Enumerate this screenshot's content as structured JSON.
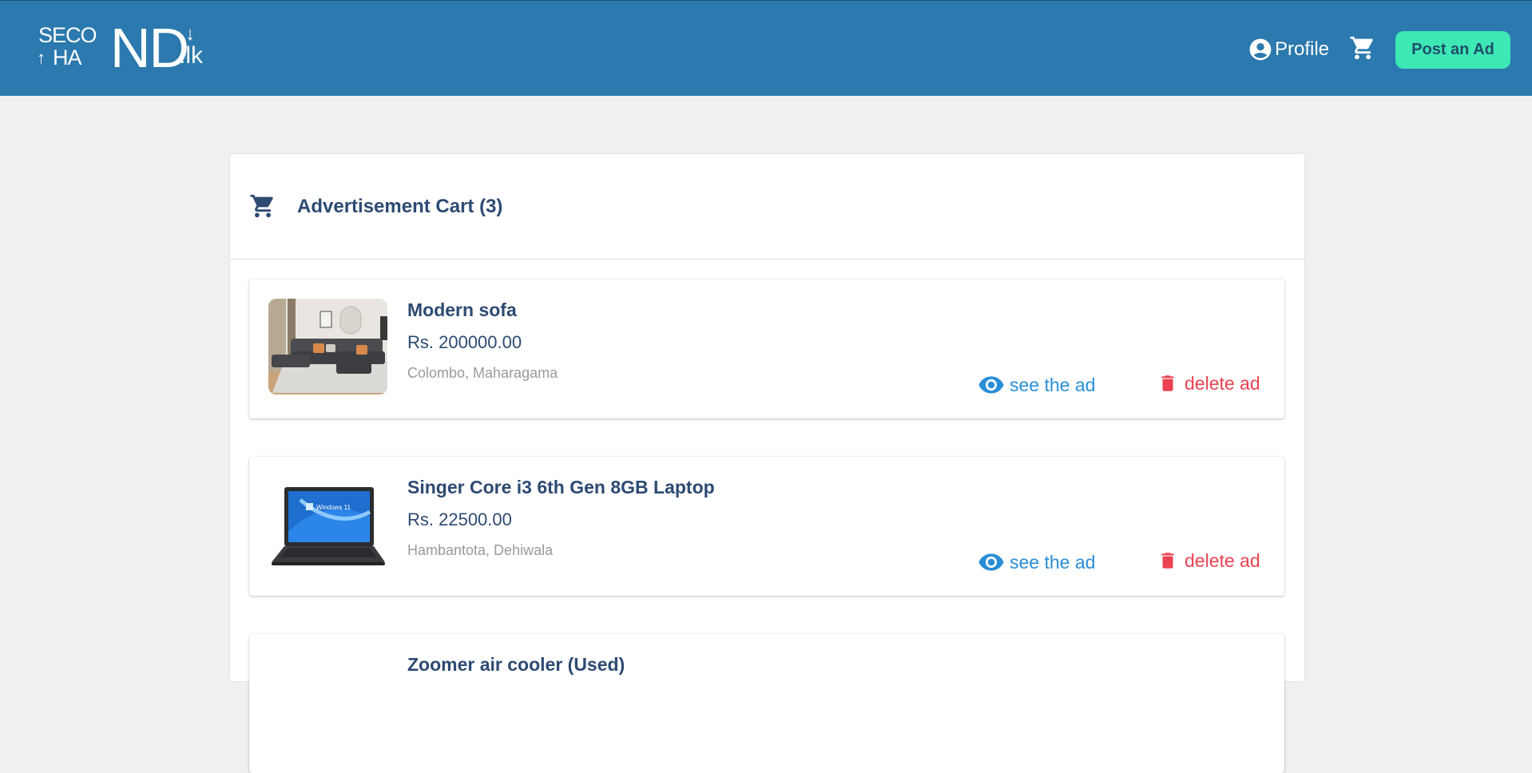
{
  "header": {
    "logo_line1": "SECO",
    "logo_line2": "HA",
    "logo_big": "ND",
    "logo_tld": ".lk",
    "profile_label": "Profile",
    "post_ad_label": "Post an Ad",
    "colors": {
      "bar": "#2b79ae",
      "post_button": "#3de8b5"
    }
  },
  "cart": {
    "title": "Advertisement Cart (3)",
    "items": [
      {
        "title": "Modern sofa",
        "price": "Rs. 200000.00",
        "location": "Colombo, Maharagama",
        "see_label": "see the ad",
        "delete_label": "delete ad",
        "image": "sofa-photo"
      },
      {
        "title": "Singer Core i3 6th Gen 8GB Laptop",
        "price": "Rs. 22500.00",
        "location": "Hambantota, Dehiwala",
        "see_label": "see the ad",
        "delete_label": "delete ad",
        "image": "laptop-photo"
      },
      {
        "title": "Zoomer air cooler (Used)",
        "price": "",
        "location": "",
        "see_label": "",
        "delete_label": "",
        "image": "air-cooler-photo"
      }
    ]
  },
  "icons": {
    "profile": "account-circle-icon",
    "cart": "shopping-cart-icon",
    "see": "eye-icon",
    "delete": "trash-icon"
  }
}
